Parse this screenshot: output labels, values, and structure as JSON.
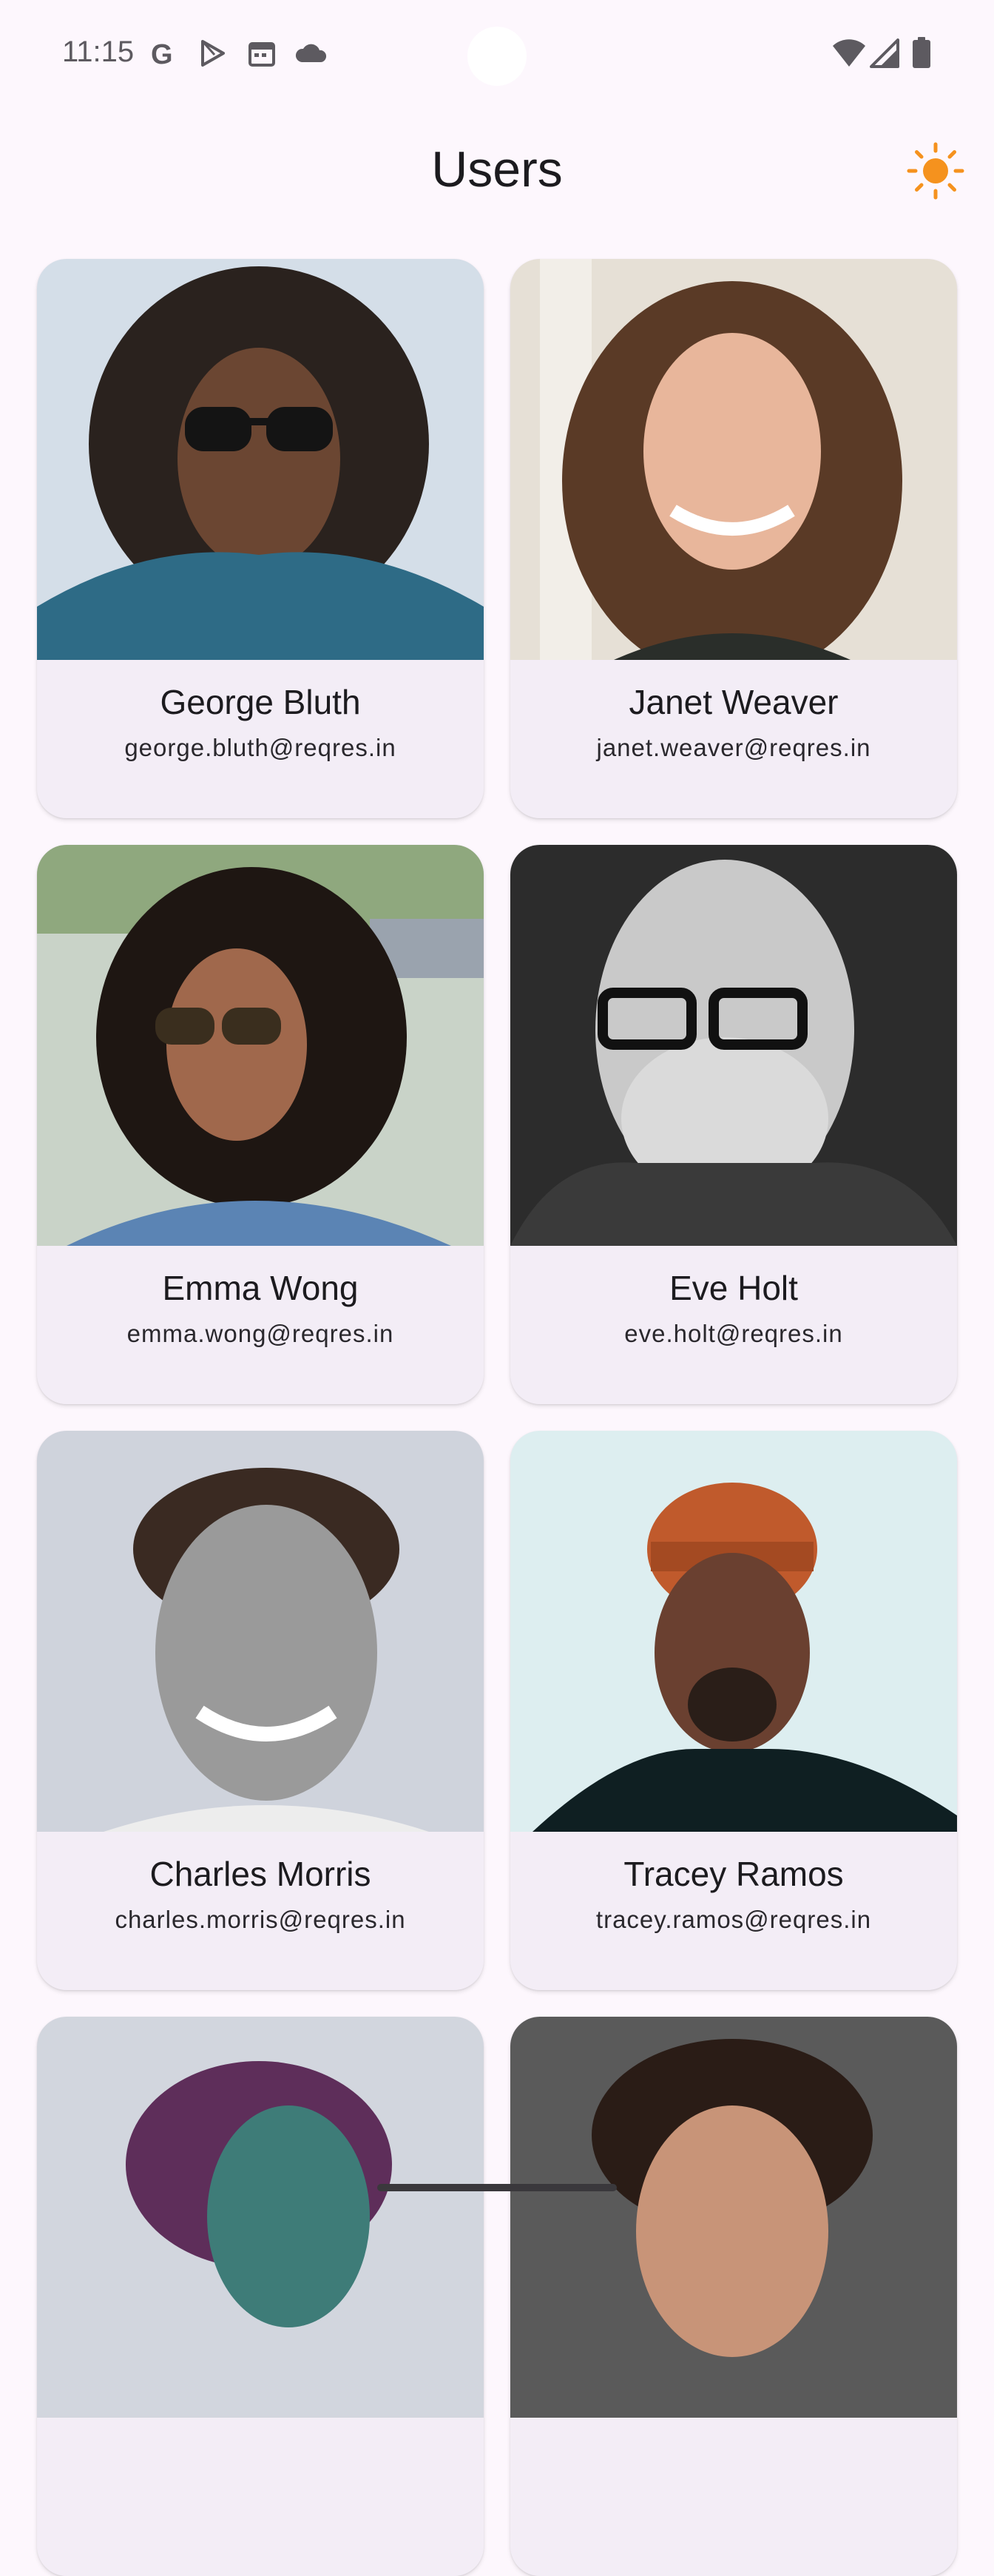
{
  "status_bar": {
    "time": "11:15",
    "left_icons": [
      "google-icon",
      "play-store-icon",
      "calendar-icon",
      "cloud-icon"
    ],
    "right_icons": [
      "wifi-icon",
      "signal-icon",
      "battery-icon"
    ]
  },
  "app_bar": {
    "title": "Users",
    "theme_toggle_icon": "sun-icon",
    "accent_color": "#F5921E"
  },
  "users": [
    {
      "name": "George Bluth",
      "email": "george.bluth@reqres.in"
    },
    {
      "name": "Janet Weaver",
      "email": "janet.weaver@reqres.in"
    },
    {
      "name": "Emma Wong",
      "email": "emma.wong@reqres.in"
    },
    {
      "name": "Eve Holt",
      "email": "eve.holt@reqres.in"
    },
    {
      "name": "Charles Morris",
      "email": "charles.morris@reqres.in"
    },
    {
      "name": "Tracey Ramos",
      "email": "tracey.ramos@reqres.in"
    },
    {
      "name": "",
      "email": ""
    },
    {
      "name": "",
      "email": ""
    }
  ],
  "colors": {
    "background": "#FDF7FD",
    "card": "#F3EDF6"
  }
}
